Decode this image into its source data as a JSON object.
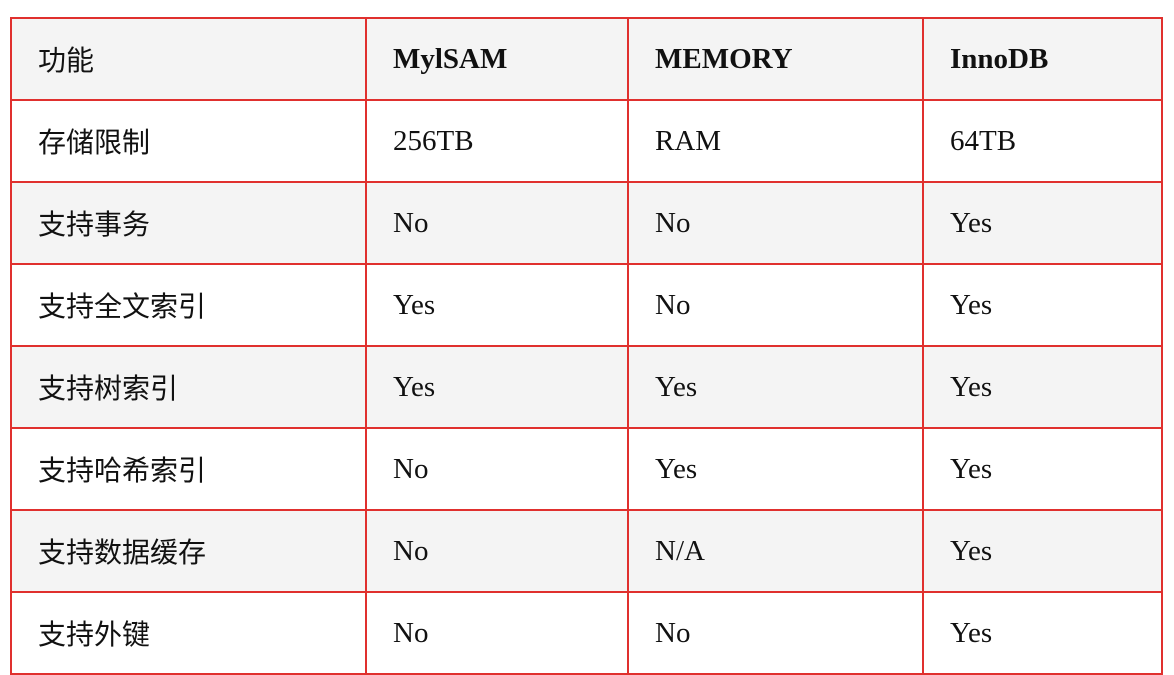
{
  "table": {
    "headers": [
      "功能",
      "MylSAM",
      "MEMORY",
      "InnoDB"
    ],
    "rows": [
      [
        "存储限制",
        "256TB",
        "RAM",
        "64TB"
      ],
      [
        "支持事务",
        "No",
        "No",
        "Yes"
      ],
      [
        "支持全文索引",
        "Yes",
        "No",
        "Yes"
      ],
      [
        "支持树索引",
        "Yes",
        "Yes",
        "Yes"
      ],
      [
        "支持哈希索引",
        "No",
        "Yes",
        "Yes"
      ],
      [
        "支持数据缓存",
        "No",
        "N/A",
        "Yes"
      ],
      [
        "支持外键",
        "No",
        "No",
        "Yes"
      ]
    ]
  },
  "colors": {
    "border": "#e0302e",
    "header_bg": "#f4f4f4",
    "alt_row_bg": "#f4f4f4",
    "text": "#111111"
  }
}
